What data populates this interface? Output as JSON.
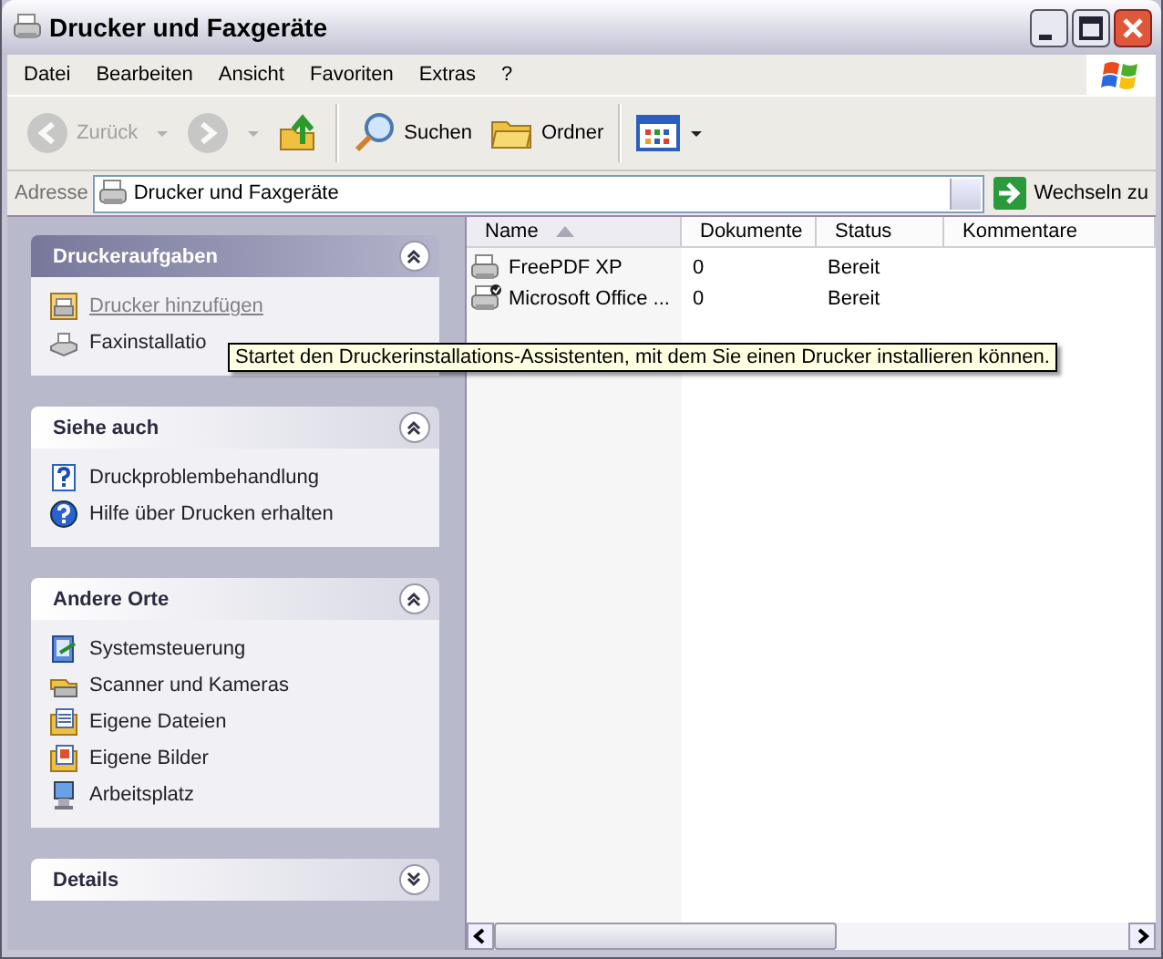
{
  "window": {
    "title": "Drucker und Faxgeräte"
  },
  "menu": [
    {
      "label": "Datei"
    },
    {
      "label": "Bearbeiten"
    },
    {
      "label": "Ansicht"
    },
    {
      "label": "Favoriten"
    },
    {
      "label": "Extras"
    },
    {
      "label": "?"
    }
  ],
  "toolbar": [
    {
      "kind": "back",
      "label": "Zurück",
      "disabled": true
    },
    {
      "kind": "forward",
      "disabled": true
    },
    {
      "kind": "up",
      "disabled": false
    },
    {
      "kind": "search",
      "label": "Suchen",
      "disabled": false
    },
    {
      "kind": "folders",
      "label": "Ordner",
      "disabled": false
    },
    {
      "kind": "views",
      "disabled": false
    }
  ],
  "address": {
    "label": "Adresse",
    "value": "Drucker und Faxgeräte",
    "go": "Wechseln zu"
  },
  "task_panes": [
    {
      "title": "Druckeraufgaben",
      "kind": "special",
      "expanded": true,
      "items": [
        {
          "label": "Drucker hinzufügen",
          "kind": "addprinter",
          "hovered": true
        },
        {
          "label": "Faxinstallatio",
          "kind": "fax",
          "hovered": false
        }
      ]
    },
    {
      "title": "Siehe auch",
      "kind": "normal",
      "expanded": true,
      "items": [
        {
          "label": "Druckproblembehandlung",
          "kind": "helpdoc",
          "hovered": false
        },
        {
          "label": "Hilfe über Drucken erhalten",
          "kind": "help",
          "hovered": false
        }
      ]
    },
    {
      "title": "Andere Orte",
      "kind": "normal",
      "expanded": true,
      "items": [
        {
          "label": "Systemsteuerung",
          "kind": "control",
          "hovered": false
        },
        {
          "label": "Scanner und Kameras",
          "kind": "scanner",
          "hovered": false
        },
        {
          "label": "Eigene Dateien",
          "kind": "docs",
          "hovered": false
        },
        {
          "label": "Eigene Bilder",
          "kind": "pics",
          "hovered": false
        },
        {
          "label": "Arbeitsplatz",
          "kind": "computer",
          "hovered": false
        }
      ]
    },
    {
      "title": "Details",
      "kind": "normal",
      "expanded": false
    }
  ],
  "table": {
    "columns": [
      {
        "label": "Name",
        "sorted": true
      },
      {
        "label": "Dokumente",
        "sorted": false
      },
      {
        "label": "Status",
        "sorted": false
      },
      {
        "label": "Kommentare",
        "sorted": false
      }
    ],
    "rows": [
      {
        "cells": [
          "FreePDF XP",
          "0",
          "Bereit"
        ],
        "default": false
      },
      {
        "cells": [
          "Microsoft Office ...",
          "0",
          "Bereit"
        ],
        "default": true
      }
    ]
  },
  "tooltip": {
    "text": "Startet den Druckerinstallations-Assistenten, mit dem Sie einen Drucker installieren können."
  }
}
